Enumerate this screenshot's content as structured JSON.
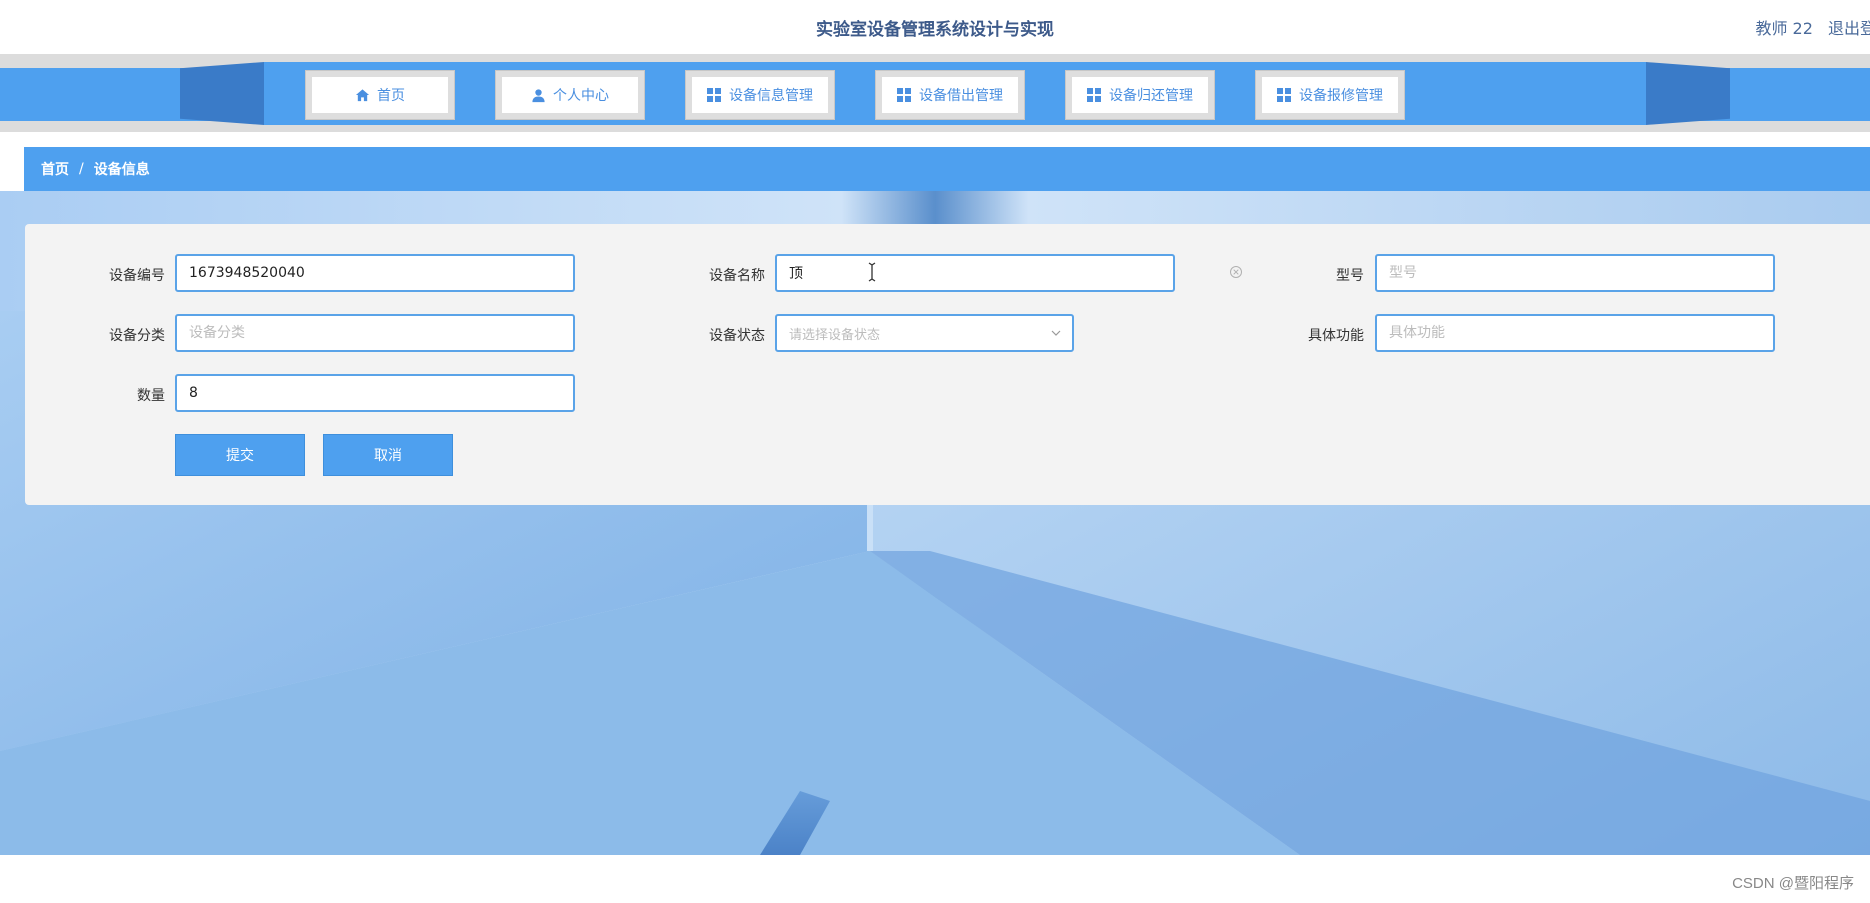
{
  "header": {
    "title": "实验室设备管理系统设计与实现",
    "user": "教师 22",
    "logout": "退出登"
  },
  "nav": {
    "items": [
      {
        "label": "首页",
        "icon": "home-icon"
      },
      {
        "label": "个人中心",
        "icon": "user-icon"
      },
      {
        "label": "设备信息管理",
        "icon": "grid-icon"
      },
      {
        "label": "设备借出管理",
        "icon": "grid-icon"
      },
      {
        "label": "设备归还管理",
        "icon": "grid-icon"
      },
      {
        "label": "设备报修管理",
        "icon": "grid-icon"
      }
    ]
  },
  "breadcrumb": {
    "home": "首页",
    "separator": "/",
    "current": "设备信息"
  },
  "form": {
    "device_no": {
      "label": "设备编号",
      "value": "1673948520040"
    },
    "device_name": {
      "label": "设备名称",
      "value": "顶"
    },
    "model": {
      "label": "型号",
      "placeholder": "型号"
    },
    "category": {
      "label": "设备分类",
      "placeholder": "设备分类"
    },
    "status": {
      "label": "设备状态",
      "placeholder": "请选择设备状态"
    },
    "function": {
      "label": "具体功能",
      "placeholder": "具体功能"
    },
    "quantity": {
      "label": "数量",
      "value": "8"
    },
    "submit": "提交",
    "cancel": "取消"
  },
  "footer": {
    "watermark": "CSDN @暨阳程序"
  },
  "colors": {
    "primary": "#4ea0ef",
    "wing": "#3a7bc8",
    "title": "#3d5a8a"
  }
}
